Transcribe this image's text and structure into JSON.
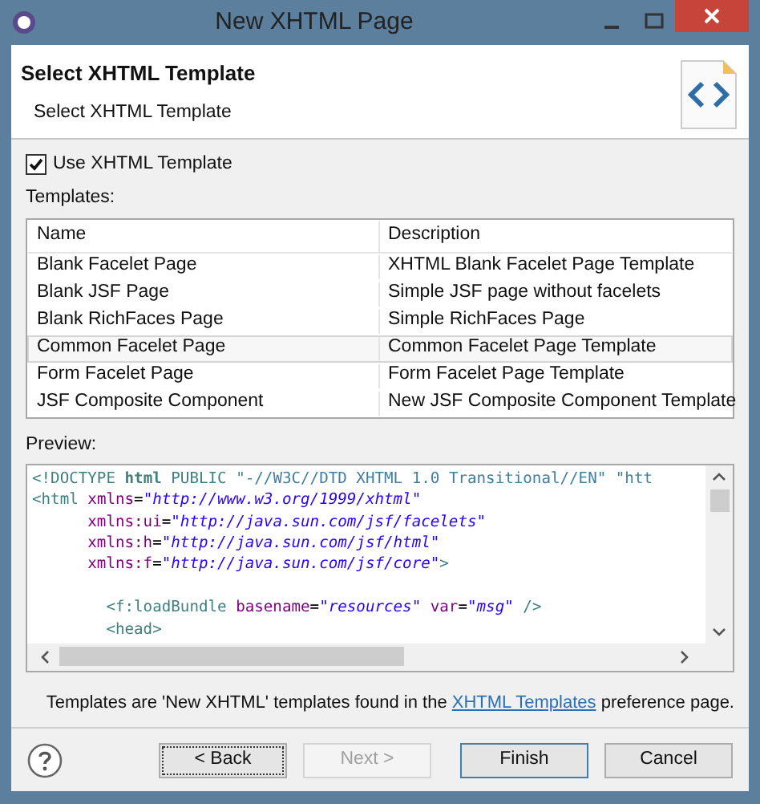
{
  "window": {
    "title": "New XHTML Page"
  },
  "header": {
    "title": "Select XHTML Template",
    "subtitle": "Select XHTML Template"
  },
  "use_template": {
    "label": "Use XHTML Template",
    "checked": true
  },
  "templates": {
    "label": "Templates:",
    "columns": [
      "Name",
      "Description"
    ],
    "rows": [
      {
        "cells": [
          "Blank Facelet Page",
          "XHTML Blank Facelet Page Template"
        ],
        "selected": false
      },
      {
        "cells": [
          "Blank JSF Page",
          "Simple JSF page without facelets"
        ],
        "selected": false
      },
      {
        "cells": [
          "Blank RichFaces Page",
          "Simple RichFaces Page"
        ],
        "selected": false
      },
      {
        "cells": [
          "Common Facelet Page",
          "Common Facelet Page Template"
        ],
        "selected": true
      },
      {
        "cells": [
          "Form Facelet Page",
          "Form Facelet Page Template"
        ],
        "selected": false
      },
      {
        "cells": [
          "JSF Composite Component",
          "New JSF Composite Component Template"
        ],
        "selected": false
      }
    ]
  },
  "preview": {
    "label": "Preview:",
    "lines": [
      {
        "tokens": [
          {
            "kind": "tag",
            "text": "<!DOCTYPE "
          },
          {
            "kind": "keyword",
            "text": "html"
          },
          {
            "kind": "tag",
            "text": " PUBLIC "
          },
          {
            "kind": "doctype",
            "text": "\"-//W3C//DTD XHTML 1.0 Transitional//EN\" \"htt"
          }
        ]
      },
      {
        "tokens": [
          {
            "kind": "tag",
            "text": "<html"
          },
          {
            "kind": "attr",
            "text": " xmlns"
          },
          {
            "kind": "plain",
            "text": "="
          },
          {
            "kind": "string",
            "text": "\"http://www.w3.org/1999/xhtml\""
          }
        ]
      },
      {
        "tokens": [
          {
            "kind": "attr",
            "text": "      xmlns:ui"
          },
          {
            "kind": "plain",
            "text": "="
          },
          {
            "kind": "string",
            "text": "\"http://java.sun.com/jsf/facelets\""
          }
        ]
      },
      {
        "tokens": [
          {
            "kind": "attr",
            "text": "      xmlns:h"
          },
          {
            "kind": "plain",
            "text": "="
          },
          {
            "kind": "string",
            "text": "\"http://java.sun.com/jsf/html\""
          }
        ]
      },
      {
        "tokens": [
          {
            "kind": "attr",
            "text": "      xmlns:f"
          },
          {
            "kind": "plain",
            "text": "="
          },
          {
            "kind": "string",
            "text": "\"http://java.sun.com/jsf/core\""
          },
          {
            "kind": "tag",
            "text": ">"
          }
        ]
      },
      {
        "kind": "blank"
      },
      {
        "tokens": [
          {
            "kind": "tag",
            "text": "        <f:loadBundle"
          },
          {
            "kind": "attr",
            "text": " basename"
          },
          {
            "kind": "plain",
            "text": "="
          },
          {
            "kind": "string",
            "text": "\"resources\""
          },
          {
            "kind": "attr",
            "text": " var"
          },
          {
            "kind": "plain",
            "text": "="
          },
          {
            "kind": "string",
            "text": "\"msg\""
          },
          {
            "kind": "tag",
            "text": " />"
          }
        ]
      },
      {
        "tokens": [
          {
            "kind": "tag",
            "text": "        <head>"
          }
        ]
      }
    ]
  },
  "note": {
    "before": "Templates are 'New XHTML' templates found in the ",
    "link": "XHTML Templates",
    "after": " preference page."
  },
  "buttons": [
    {
      "label": "< Back",
      "disabled": false,
      "focused": true,
      "default": false
    },
    {
      "label": "Next >",
      "disabled": true,
      "focused": false,
      "default": false
    },
    {
      "label": "Finish",
      "disabled": false,
      "focused": false,
      "default": true
    },
    {
      "label": "Cancel",
      "disabled": false,
      "focused": false,
      "default": false
    }
  ]
}
